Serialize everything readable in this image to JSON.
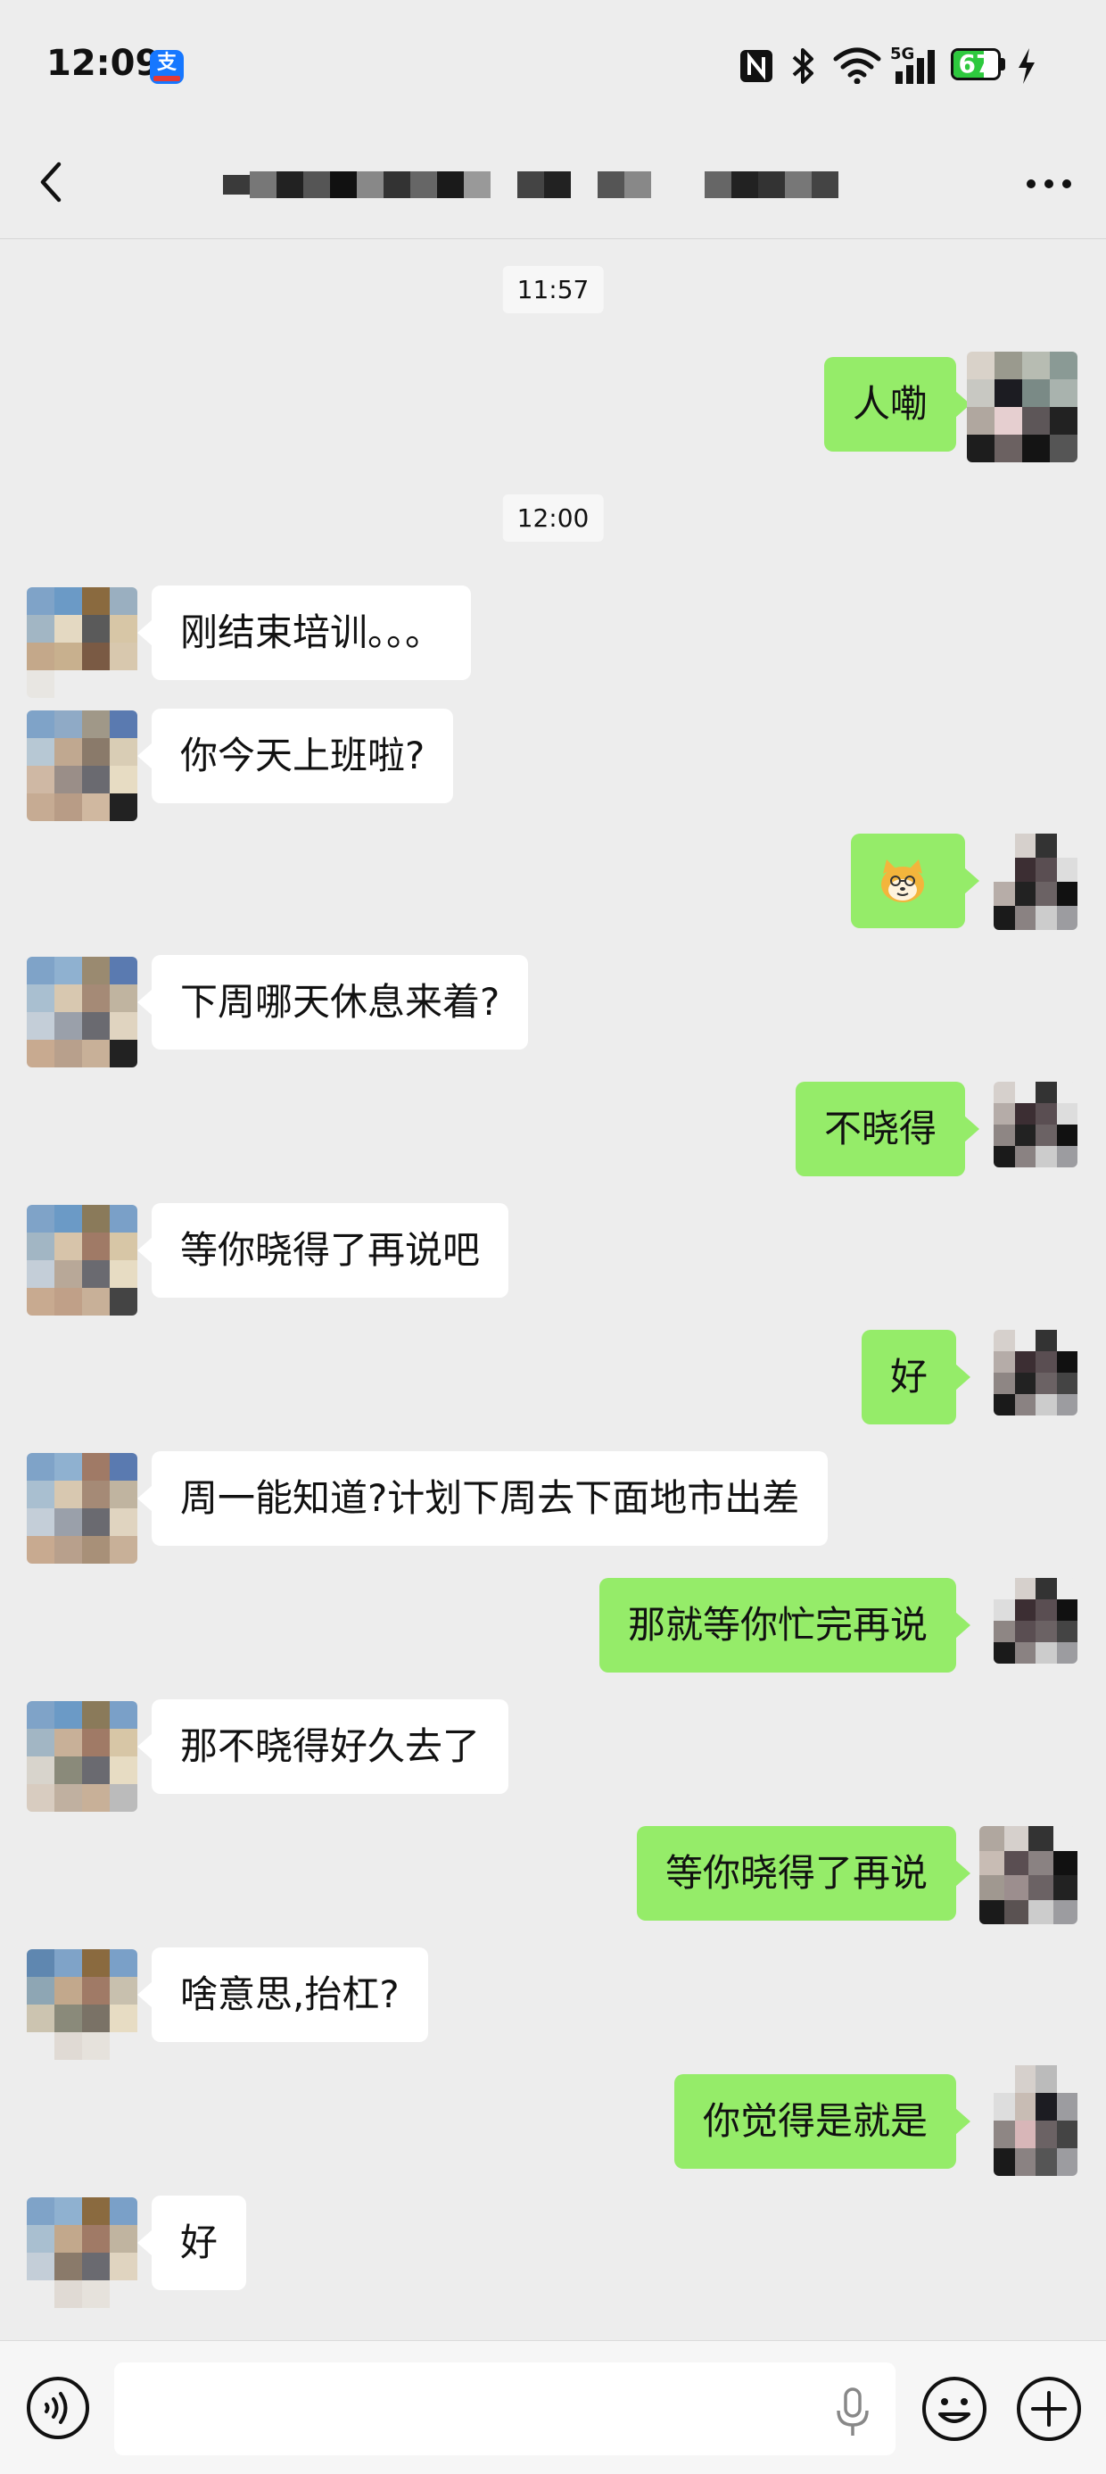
{
  "status_bar": {
    "time": "12:09",
    "app_icon_label": "支",
    "battery_level": "67",
    "network": "5G",
    "icons": [
      "nfc-icon",
      "bluetooth-icon",
      "wifi-icon",
      "signal-icon",
      "battery-icon",
      "charging-icon"
    ]
  },
  "nav": {
    "title": "",
    "back_icon": "chevron-left-icon",
    "more_icon": "more-horizontal-icon"
  },
  "chat": {
    "timestamps": [
      "11:57",
      "12:00"
    ],
    "messages": [
      {
        "side": "out",
        "text": "人嘞"
      },
      {
        "side": "in",
        "text": "刚结束培训。。。"
      },
      {
        "side": "in",
        "text": "你今天上班啦?"
      },
      {
        "side": "out",
        "text": "",
        "sticker": "doge-sticker"
      },
      {
        "side": "in",
        "text": "下周哪天休息来着?"
      },
      {
        "side": "out",
        "text": "不晓得"
      },
      {
        "side": "in",
        "text": "等你晓得了再说吧"
      },
      {
        "side": "out",
        "text": "好"
      },
      {
        "side": "in",
        "text": "周一能知道?计划下周去下面地市出差"
      },
      {
        "side": "out",
        "text": "那就等你忙完再说"
      },
      {
        "side": "in",
        "text": "那不晓得好久去了"
      },
      {
        "side": "out",
        "text": "等你晓得了再说"
      },
      {
        "side": "in",
        "text": "啥意思,抬杠?"
      },
      {
        "side": "out",
        "text": "你觉得是就是"
      },
      {
        "side": "in",
        "text": "好"
      }
    ]
  },
  "input_bar": {
    "input_value": "",
    "voice_icon": "voice-icon",
    "mic_icon": "microphone-icon",
    "emoji_icon": "emoji-icon",
    "plus_icon": "plus-icon"
  },
  "colors": {
    "background": "#ededed",
    "outgoing_bubble": "#95ec69",
    "incoming_bubble": "#ffffff",
    "battery_green": "#2ec93e"
  }
}
